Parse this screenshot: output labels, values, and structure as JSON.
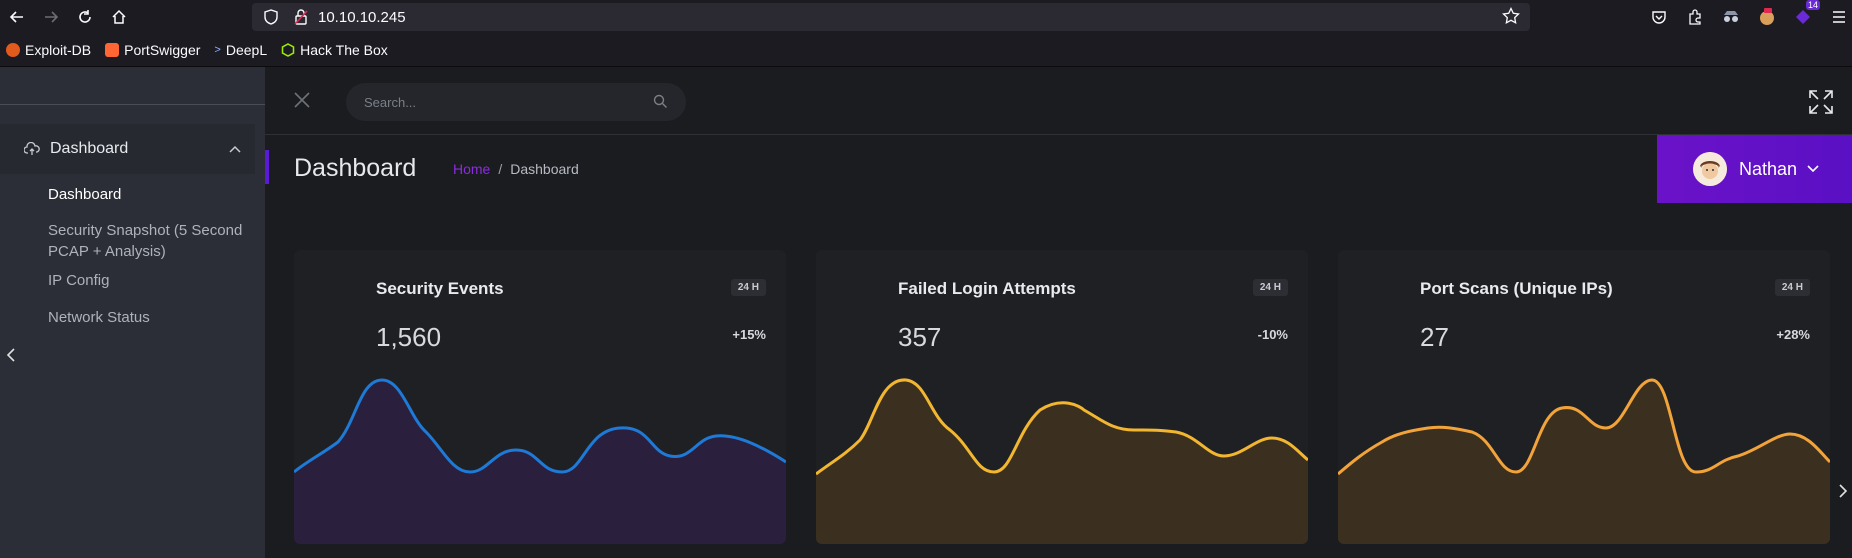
{
  "browser": {
    "url": "10.10.10.245",
    "bookmarks": [
      {
        "label": "Exploit-DB",
        "color": "#e25a1c"
      },
      {
        "label": "PortSwigger",
        "color": "#ff6633"
      },
      {
        "label": "DeepL",
        "color": "#0f2b46"
      },
      {
        "label": "Hack The Box",
        "color": "#9fef00"
      }
    ],
    "extension_badge": "14"
  },
  "sidebar": {
    "menu_label": "Dashboard",
    "items": [
      {
        "label": "Dashboard",
        "active": true
      },
      {
        "label": "Security Snapshot (5 Second PCAP + Analysis)",
        "active": false
      },
      {
        "label": "IP Config",
        "active": false
      },
      {
        "label": "Network Status",
        "active": false
      }
    ]
  },
  "header": {
    "search_placeholder": "Search...",
    "page_title": "Dashboard",
    "breadcrumb_home": "Home",
    "breadcrumb_sep": "/",
    "breadcrumb_current": "Dashboard",
    "user_name": "Nathan"
  },
  "cards": [
    {
      "title": "Security Events",
      "tag": "24 H",
      "value": "1,560",
      "delta": "+15%",
      "color": "#1e7ad6",
      "fill": "#2a1f3d"
    },
    {
      "title": "Failed Login Attempts",
      "tag": "24 H",
      "value": "357",
      "delta": "-10%",
      "color": "#f2b631",
      "fill": "#3b3020"
    },
    {
      "title": "Port Scans (Unique IPs)",
      "tag": "24 H",
      "value": "27",
      "delta": "+28%",
      "color": "#f2a33a",
      "fill": "#3b3020"
    }
  ]
}
